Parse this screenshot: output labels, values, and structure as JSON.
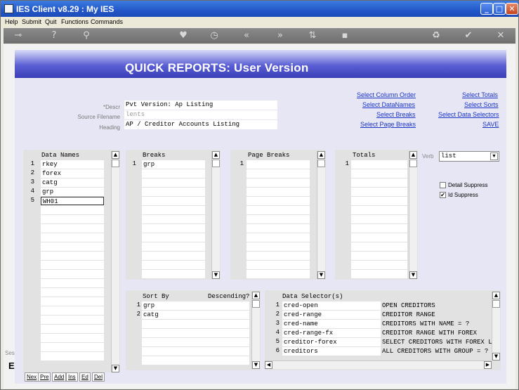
{
  "window": {
    "title": "IES Client v8.29 : My IES",
    "min": "_",
    "max": "□",
    "close": "✕"
  },
  "menu": [
    "Help",
    "Submit",
    "Quit",
    "Functions",
    "Commands"
  ],
  "toolbar_icons": [
    "key-icon",
    "help-icon",
    "search-icon",
    "heart-icon",
    "clock-icon",
    "rewind-icon",
    "forward-icon",
    "ab-icon",
    "stop-icon",
    "recycle-icon",
    "check-icon",
    "close-icon"
  ],
  "header": {
    "title": "QUICK REPORTS: User Version"
  },
  "form": {
    "descr_label": "*Descr",
    "descr_value": "Pvt Version: Ap Listing",
    "source_label": "Source Filename",
    "source_value": "lents",
    "heading_label": "Heading",
    "heading_value": "AP / Creditor Accounts Listing"
  },
  "links": {
    "select_column_order": "Select Column Order",
    "select_datanames": "Select DataNames",
    "select_breaks": "Select Breaks",
    "select_page_breaks": "Select Page Breaks",
    "select_totals": "Select Totals",
    "select_sorts": "Select Sorts",
    "select_data_selectors": "Select Data Selectors",
    "save": "SAVE"
  },
  "verb": {
    "label": "Verb",
    "value": "list"
  },
  "options": {
    "detail_suppress": "Detail Suppress",
    "detail_checked": false,
    "id_suppress": "Id Suppress",
    "id_checked": true
  },
  "data_names": {
    "header": "Data Names",
    "rows": [
      [
        "1",
        "rkey"
      ],
      [
        "2",
        "forex"
      ],
      [
        "3",
        "catg"
      ],
      [
        "4",
        "grp"
      ],
      [
        "5",
        "WH01"
      ]
    ]
  },
  "breaks": {
    "header": "Breaks",
    "rows": [
      [
        "1",
        "grp"
      ]
    ]
  },
  "page_breaks": {
    "header": "Page Breaks",
    "rows": [
      [
        "1",
        ""
      ]
    ]
  },
  "totals": {
    "header": "Totals",
    "rows": [
      [
        "1",
        ""
      ]
    ]
  },
  "sort_by": {
    "header": "Sort By",
    "header2": "Descending?",
    "rows": [
      [
        "1",
        "grp"
      ],
      [
        "2",
        "catg"
      ]
    ]
  },
  "data_selectors": {
    "header": "Data Selector(s)",
    "rows": [
      [
        "1",
        "cred-open",
        "OPEN CREDITORS"
      ],
      [
        "2",
        "cred-range",
        "CREDITOR RANGE"
      ],
      [
        "3",
        "cred-name",
        "CREDITORS WITH NAME = ?"
      ],
      [
        "4",
        "cred-range-fx",
        "CREDITOR RANGE WITH FOREX"
      ],
      [
        "5",
        "creditor-forex",
        "SELECT CREDITORS WITH FOREX LI"
      ],
      [
        "6",
        "creditors",
        "ALL CREDITORS WITH GROUP = ?"
      ]
    ]
  },
  "bottom_buttons": [
    "Nex",
    "Pre",
    "Add",
    "Ins",
    "Ed",
    "Del"
  ],
  "left_edge": {
    "ses": "Ses",
    "e": "E"
  }
}
